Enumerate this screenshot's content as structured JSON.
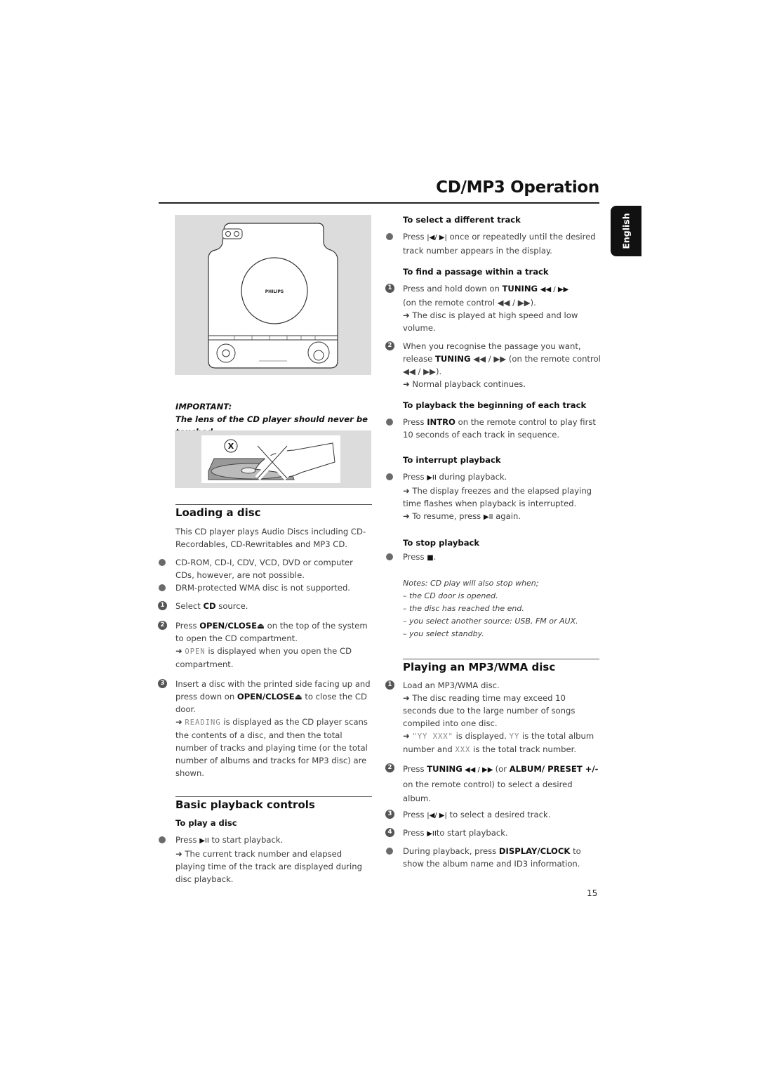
{
  "header": {
    "title": "CD/MP3 Operation",
    "language_tab": "English"
  },
  "figure_device": {
    "brand": "PHILIPS",
    "description": "Top view of CD micro system with disc compartment"
  },
  "important": {
    "label": "IMPORTANT:",
    "text": "The lens of the CD player should never be touched.",
    "figure_marker": "X"
  },
  "loading": {
    "title": "Loading a disc",
    "intro": "This CD player plays Audio Discs including CD-Recordables, CD-Rewritables and MP3 CD.",
    "bullets": [
      "CD-ROM, CD-I, CDV, VCD, DVD or computer CDs, however, are not possible.",
      "DRM-protected WMA disc is not supported."
    ],
    "steps": [
      {
        "num": "1",
        "pre": "Select ",
        "bold": "CD",
        "post": " source."
      },
      {
        "num": "2",
        "pre": "Press ",
        "bold": "OPEN/CLOSE⏏",
        "post": " on the top of the system to open the CD compartment.",
        "result_lcd": "OPEN",
        "result": " is displayed when you open the CD compartment."
      },
      {
        "num": "3",
        "pre": "Insert a disc with the printed side facing up and press down on ",
        "bold": "OPEN/CLOSE⏏",
        "post": " to close the CD door.",
        "result_lcd": "READING",
        "result": " is displayed as the CD player scans the contents of a disc, and then the total number of tracks and playing time (or the total number of albums and tracks for MP3 disc) are shown."
      }
    ]
  },
  "basic": {
    "title": "Basic playback controls",
    "play_sub": "To play a disc",
    "play_pre": "Press ",
    "play_glyph": "▶II",
    "play_post": " to start playback.",
    "play_result": "The current track number and elapsed playing time of the track are displayed during disc playback."
  },
  "right": {
    "select_sub": "To select a different track",
    "select_pre": "Press ",
    "select_glyph": "|◀/ ▶|",
    "select_post": " once or repeatedly until the desired track number appears in the display.",
    "find_sub": "To find a passage within a track",
    "find_step1_pre": "Press and hold down on ",
    "find_step1_bold": "TUNING",
    "find_step1_glyph": "◀◀ / ▶▶",
    "find_step1_post": "(on the remote control ◀◀ / ▶▶).",
    "find_step1_result": "The disc is played at high speed and low volume.",
    "find_step2_pre": "When you recognise the passage you want, release ",
    "find_step2_bold": "TUNING",
    "find_step2_post": " ◀◀ / ▶▶  (on the remote control ◀◀ / ▶▶).",
    "find_step2_result": "Normal playback continues.",
    "intro_sub": "To playback the beginning of each track",
    "intro_pre": "Press ",
    "intro_bold": "INTRO",
    "intro_post": " on the remote control to play first 10 seconds of each track in sequence.",
    "interrupt_sub": "To interrupt playback",
    "interrupt_pre": "Press ",
    "interrupt_glyph": "▶II",
    "interrupt_post": " during playback.",
    "interrupt_result1": "The display freezes and the elapsed playing time flashes when playback is interrupted.",
    "interrupt_result2_pre": "To resume, press ",
    "interrupt_result2_post": " again.",
    "stop_sub": "To stop playback",
    "stop_pre": "Press ",
    "stop_glyph": "■",
    "stop_post": ".",
    "notes": [
      "Notes: CD play will also stop when;",
      "– the CD door is opened.",
      "– the disc has reached the end.",
      "– you select another source: USB, FM or AUX.",
      "– you select standby."
    ]
  },
  "mp3": {
    "title": "Playing an MP3/WMA disc",
    "step1": "Load an MP3/WMA disc.",
    "step1_result1": "The disc reading time may exceed 10 seconds due to the large number of songs compiled into one disc.",
    "step1_result2_lcd": "\"YY XXX\"",
    "step1_result2_a": " is displayed. ",
    "step1_result2_lcd2": "YY",
    "step1_result2_b": " is the total album number and ",
    "step1_result2_lcd3": "XXX",
    "step1_result2_c": " is the total track number.",
    "step2_pre": "Press ",
    "step2_bold": "TUNING",
    "step2_glyph": " ◀◀ / ▶▶ ",
    "step2_mid": " (or ",
    "step2_bold2": "ALBUM/ PRESET +/-",
    "step2_post": "  on the remote control) to select a desired album.",
    "step3_pre": "Press ",
    "step3_glyph": "|◀/ ▶|",
    "step3_post": " to select a desired track.",
    "step4_pre": "Press ",
    "step4_glyph": "▶II",
    "step4_post": "to start playback.",
    "tip_pre": "During playback, press ",
    "tip_bold": "DISPLAY/CLOCK",
    "tip_post": " to show the album name and ID3 information."
  },
  "footer": {
    "page_number": "15"
  }
}
